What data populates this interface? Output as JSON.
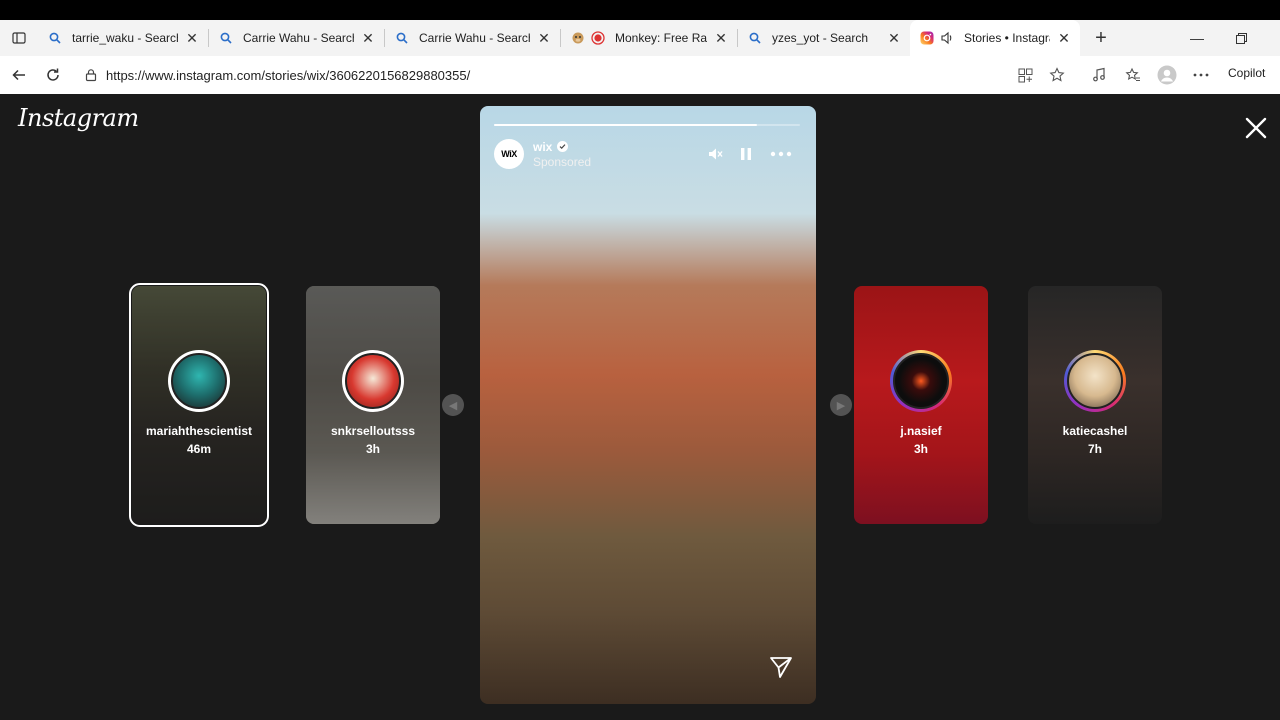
{
  "browser": {
    "tabs": [
      {
        "title": "tarrie_waku - Search",
        "icon": "search-icon"
      },
      {
        "title": "Carrie Wahu - Search",
        "icon": "search-icon"
      },
      {
        "title": "Carrie Wahu - Search Im",
        "icon": "search-icon"
      },
      {
        "title": "Monkey: Free Ran",
        "icon": "monkey-icon"
      },
      {
        "title": "yzes_yot - Search",
        "icon": "search-icon"
      },
      {
        "title": "Stories • Instagram",
        "icon": "instagram-icon",
        "active": true
      }
    ],
    "url": "https://www.instagram.com/stories/wix/3606220156829880355/",
    "copilot_label": "Copilot"
  },
  "instagram": {
    "logo": "Instagram",
    "stories": [
      {
        "username": "mariahthescientist",
        "time": "46m",
        "selected": true
      },
      {
        "username": "snkrselloutsss",
        "time": "3h"
      },
      {
        "username": "j.nasief",
        "time": "3h"
      },
      {
        "username": "katiecashel",
        "time": "7h"
      }
    ],
    "current": {
      "username": "wix",
      "avatar_text": "WiX",
      "sponsored_label": "Sponsored",
      "progress": 0.86
    }
  },
  "colors": {
    "background": "#1a1a1a",
    "ig_gradient": [
      "#feda75",
      "#fa7e1e",
      "#d62976",
      "#962fbf",
      "#4f5bd5"
    ]
  }
}
